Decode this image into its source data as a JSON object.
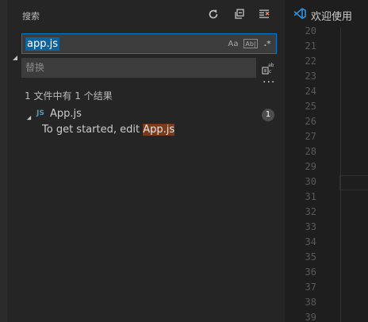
{
  "sidebar": {
    "title": "搜索",
    "actions": [
      {
        "name": "refresh-icon"
      },
      {
        "name": "collapse-all-icon"
      },
      {
        "name": "clear-results-icon"
      }
    ],
    "search": {
      "value": "app.js",
      "options": [
        {
          "name": "match-case-icon",
          "label": "Aa"
        },
        {
          "name": "whole-word-icon",
          "label": "Ab|"
        },
        {
          "name": "regex-icon",
          "label": ".*"
        }
      ]
    },
    "replace": {
      "placeholder": "替换"
    },
    "summary": "1 文件中有 1 个结果",
    "results": [
      {
        "file_icon": "JS",
        "file_name": "App.js",
        "count": "1",
        "match_prefix": "To get started, edit ",
        "match_hit": "App.js"
      }
    ]
  },
  "editor": {
    "tab_label": "欢迎使用",
    "line_numbers": [
      "20",
      "21",
      "22",
      "23",
      "24",
      "25",
      "26",
      "27",
      "28",
      "29",
      "30",
      "31",
      "32",
      "33",
      "34",
      "35",
      "36",
      "37",
      "38",
      "39"
    ]
  },
  "colors": {
    "accent": "#007acc",
    "selection": "#0e639c",
    "match_highlight": "#7a3b1d"
  }
}
